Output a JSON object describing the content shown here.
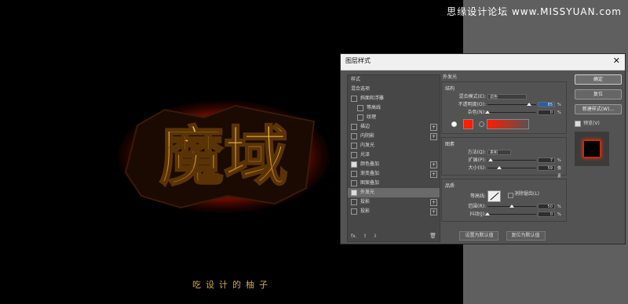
{
  "watermark": "思缘设计论坛 www.MISSYUAN.com",
  "artwork": {
    "title_chars": "魔域",
    "caption": "吃设计的柚子"
  },
  "dialog": {
    "title": "图层样式",
    "close": "✕",
    "left_list": [
      {
        "label": "样式",
        "checkbox": false,
        "plus": false,
        "selected": false,
        "sub": false
      },
      {
        "label": "混合选项",
        "checkbox": false,
        "plus": false,
        "selected": false,
        "sub": false
      },
      {
        "label": "斜面和浮雕",
        "checkbox": true,
        "checked": false,
        "plus": false,
        "selected": false,
        "sub": false
      },
      {
        "label": "等高线",
        "checkbox": true,
        "checked": false,
        "plus": false,
        "selected": false,
        "sub": true
      },
      {
        "label": "纹理",
        "checkbox": true,
        "checked": false,
        "plus": false,
        "selected": false,
        "sub": true
      },
      {
        "label": "描边",
        "checkbox": true,
        "checked": false,
        "plus": true,
        "selected": false,
        "sub": false
      },
      {
        "label": "内阴影",
        "checkbox": true,
        "checked": false,
        "plus": true,
        "selected": false,
        "sub": false
      },
      {
        "label": "内发光",
        "checkbox": true,
        "checked": false,
        "plus": false,
        "selected": false,
        "sub": false
      },
      {
        "label": "光泽",
        "checkbox": true,
        "checked": false,
        "plus": false,
        "selected": false,
        "sub": false
      },
      {
        "label": "颜色叠加",
        "checkbox": true,
        "checked": true,
        "plus": true,
        "selected": false,
        "sub": false
      },
      {
        "label": "渐变叠加",
        "checkbox": true,
        "checked": false,
        "plus": true,
        "selected": false,
        "sub": false
      },
      {
        "label": "图案叠加",
        "checkbox": true,
        "checked": false,
        "plus": false,
        "selected": false,
        "sub": false
      },
      {
        "label": "外发光",
        "checkbox": true,
        "checked": true,
        "plus": false,
        "selected": true,
        "sub": false
      },
      {
        "label": "投影",
        "checkbox": true,
        "checked": false,
        "plus": true,
        "selected": false,
        "sub": false
      },
      {
        "label": "投影",
        "checkbox": true,
        "checked": false,
        "plus": true,
        "selected": false,
        "sub": false
      }
    ],
    "bottom_icons": [
      "fx.",
      "⇧",
      "⇩"
    ],
    "trash": "🗑",
    "outer_glow": {
      "heading": "外发光",
      "structure": "结构",
      "blend_mode_label": "混合模式(E):",
      "blend_mode_value": "滤色",
      "opacity_label": "不透明度(O):",
      "opacity_value": "85",
      "opacity_level": 0.85,
      "noise_label": "杂色(N):",
      "noise_value": "0",
      "noise_level": 0,
      "percent": "%",
      "glow_color": "#ff1c00",
      "elements": "图素",
      "method_label": "方法(Q):",
      "method_value": "柔和",
      "spread_label": "扩展(P):",
      "spread_value": "7",
      "spread_level": 0.07,
      "size_label": "大小(S):",
      "size_value": "59",
      "size_level": 0.24,
      "px": "像素",
      "quality": "品质",
      "contour_label": "等高线:",
      "anti_alias": "消除锯齿(L)",
      "range_label": "范围(R):",
      "range_value": "50",
      "range_level": 0.5,
      "jitter_label": "抖动(J):",
      "jitter_value": "0",
      "jitter_level": 0,
      "btn_default": "设置为默认值",
      "btn_reset": "复位为默认值"
    },
    "buttons": {
      "ok": "确定",
      "reset": "复位",
      "new_style": "新建样式(W)...",
      "preview": "预览(V)"
    }
  }
}
